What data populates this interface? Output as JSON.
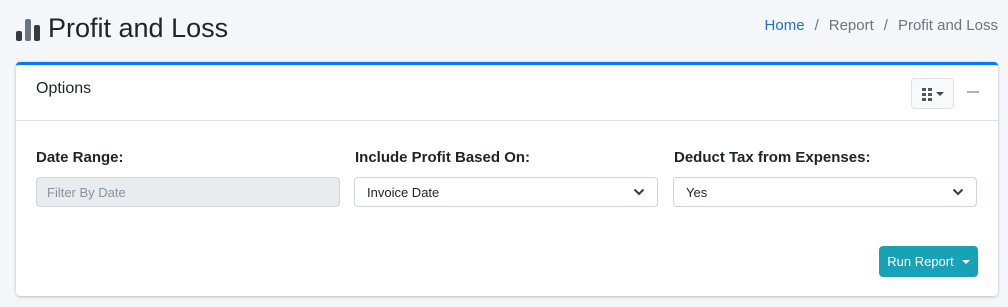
{
  "header": {
    "title": "Profit and Loss",
    "breadcrumb": [
      {
        "label": "Home"
      },
      {
        "label": "Report"
      },
      {
        "label": "Profit and Loss"
      }
    ],
    "separator": "/"
  },
  "card": {
    "title": "Options",
    "accent_color": "#007bff",
    "tools": {
      "dropdown_icon": "building-grid-icon",
      "collapse_icon": "minus-icon"
    },
    "fields": {
      "date_range": {
        "label": "Date Range:",
        "placeholder": "Filter By Date",
        "value": ""
      },
      "profit_based_on": {
        "label": "Include Profit Based On:",
        "selected": "Invoice Date"
      },
      "deduct_tax": {
        "label": "Deduct Tax from Expenses:",
        "selected": "Yes"
      }
    },
    "run_button": {
      "label": "Run Report",
      "color": "#17a2b8"
    }
  }
}
